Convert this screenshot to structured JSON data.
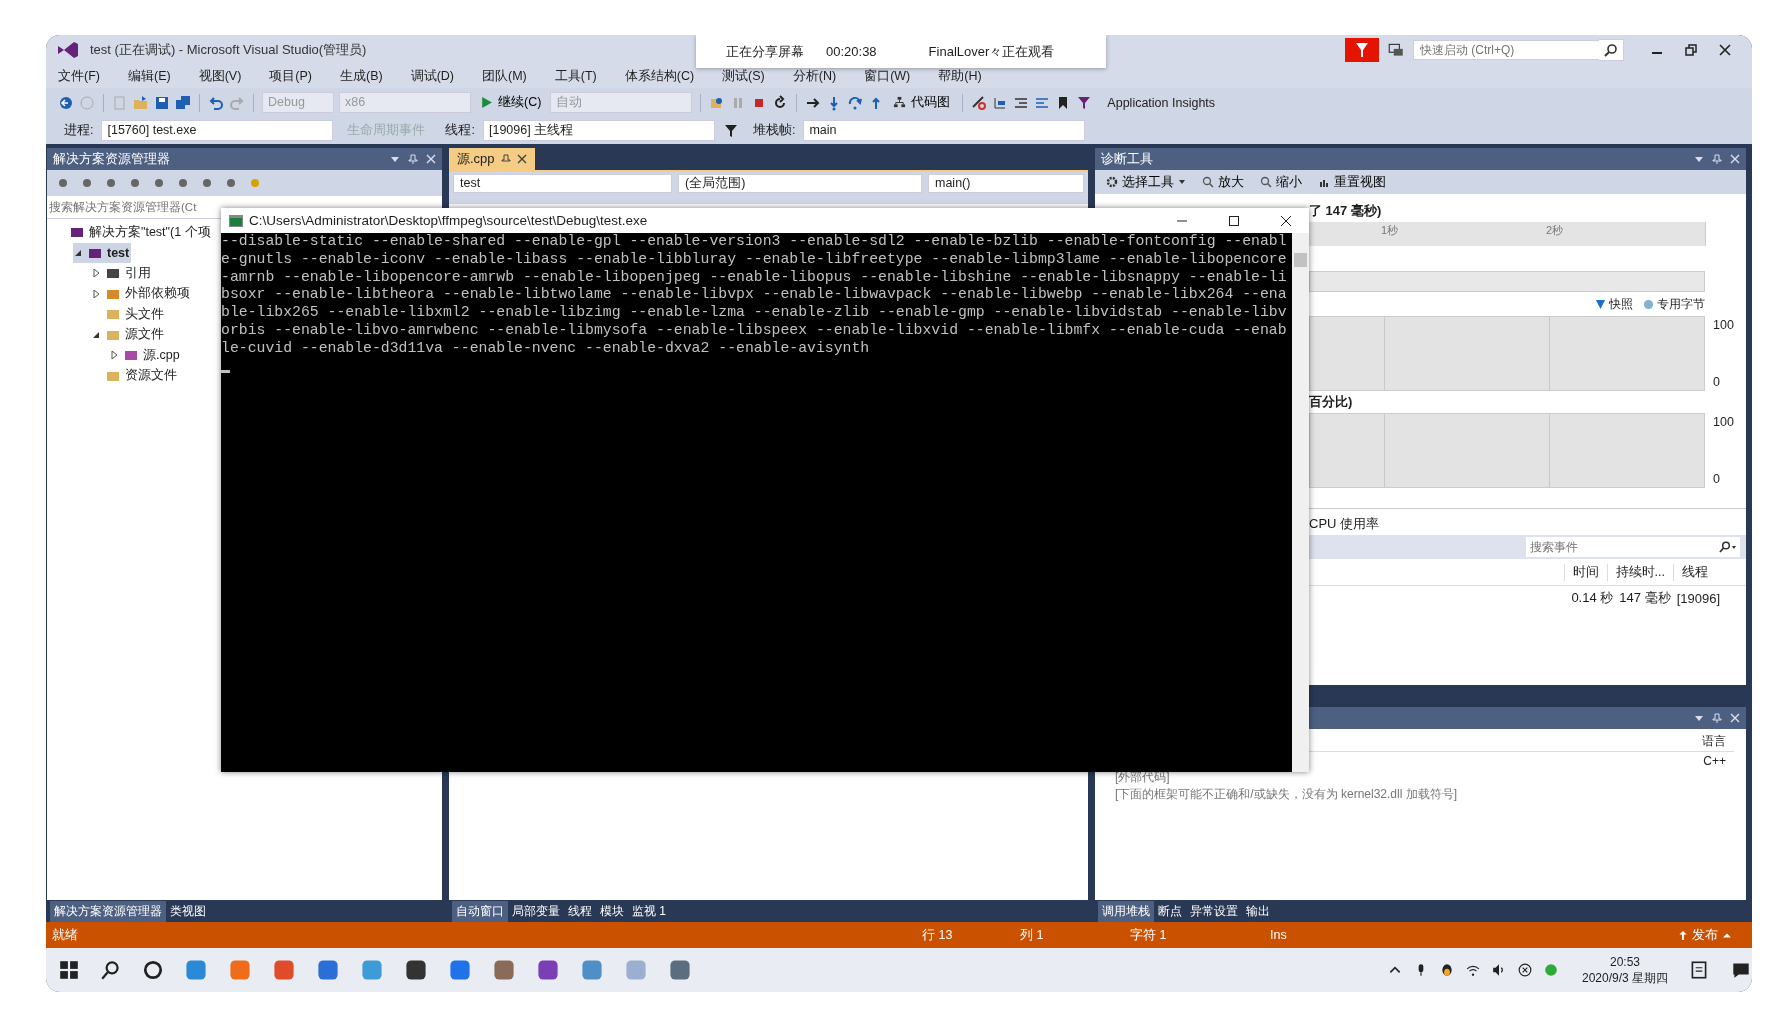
{
  "window": {
    "title": "test (正在调试) - Microsoft Visual Studio(管理员)"
  },
  "share_banner": {
    "status": "正在分享屏幕",
    "time": "00:20:38",
    "viewer": "FinalLover々正在观看"
  },
  "quick_launch": {
    "placeholder": "快速启动 (Ctrl+Q)"
  },
  "menu": [
    "文件(F)",
    "编辑(E)",
    "视图(V)",
    "项目(P)",
    "生成(B)",
    "调试(D)",
    "团队(M)",
    "工具(T)",
    "体系结构(C)",
    "测试(S)",
    "分析(N)",
    "窗口(W)",
    "帮助(H)"
  ],
  "toolbar": {
    "configuration": "Debug",
    "platform": "x86",
    "continue": "继续(C)",
    "auto": "自动",
    "code_map": "代码图",
    "insights": "Application Insights"
  },
  "debug_location": {
    "process_label": "进程:",
    "process": "[15760] test.exe",
    "lifecycle": "生命周期事件",
    "thread_label": "线程:",
    "thread": "[19096] 主线程",
    "stack_label": "堆栈帧:",
    "stack": "main"
  },
  "solution_explorer": {
    "title": "解决方案资源管理器",
    "search": {
      "placeholder": "搜索解决方案资源管理器(Ct"
    },
    "tree": [
      {
        "label": "解决方案\"test\"(1 个项",
        "kind": "solution",
        "selected": false,
        "children": [
          {
            "label": "test",
            "kind": "project",
            "expanded": true,
            "selected": true,
            "children": [
              {
                "label": "引用",
                "kind": "references",
                "expanded": false,
                "selected": false
              },
              {
                "label": "外部依赖项",
                "kind": "external",
                "expanded": false,
                "selected": false
              },
              {
                "label": "头文件",
                "kind": "folder",
                "selected": false
              },
              {
                "label": "源文件",
                "kind": "folder",
                "expanded": true,
                "selected": false,
                "children": [
                  {
                    "label": "源.cpp",
                    "kind": "cpp",
                    "expanded": false,
                    "selected": false
                  }
                ]
              },
              {
                "label": "资源文件",
                "kind": "folder",
                "selected": false
              }
            ]
          }
        ]
      }
    ],
    "tabs": [
      {
        "label": "解决方案资源管理器",
        "selected": true
      },
      {
        "label": "类视图",
        "selected": false
      }
    ]
  },
  "editor": {
    "tabs": [
      {
        "label": "源.cpp",
        "selected": true
      }
    ],
    "project": "test",
    "scope": "(全局范围)",
    "member": "main()"
  },
  "console": {
    "title": "C:\\Users\\Administrator\\Desktop\\ffmpeg\\source\\test\\Debug\\test.exe",
    "lines": [
      "--disable-static --enable-shared --enable-gpl --enable-version3 --enable-sdl2 --enable-bzlib --enable-fontconfig --enabl",
      "e-gnutls --enable-iconv --enable-libass --enable-libbluray --enable-libfreetype --enable-libmp3lame --enable-libopencore",
      "-amrnb --enable-libopencore-amrwb --enable-libopenjpeg --enable-libopus --enable-libshine --enable-libsnappy --enable-li",
      "bsoxr --enable-libtheora --enable-libtwolame --enable-libvpx --enable-libwavpack --enable-libwebp --enable-libx264 --ena",
      "ble-libx265 --enable-libxml2 --enable-libzimg --enable-lzma --enable-zlib --enable-gmp --enable-libvidstab --enable-libv",
      "orbis --enable-libvo-amrwbenc --enable-libmysofa --enable-libspeex --enable-libxvid --enable-libmfx --enable-cuda --enab",
      "le-cuvid --enable-d3d11va --enable-nvenc --enable-dxva2 --enable-avisynth"
    ]
  },
  "autos": {
    "tabs": [
      {
        "label": "自动窗口",
        "selected": true
      },
      {
        "label": "局部变量",
        "selected": false
      },
      {
        "label": "线程",
        "selected": false
      },
      {
        "label": "模块",
        "selected": false
      },
      {
        "label": "监视 1",
        "selected": false
      }
    ]
  },
  "diagnostics": {
    "title": "诊断工具",
    "select_tool": "选择工具",
    "zoom_in": "放大",
    "zoom_out": "缩小",
    "reset_view": "重置视图",
    "session": "了 147 毫秒)",
    "ticks": [
      "1秒",
      "2秒"
    ],
    "legend": [
      {
        "label": "快照",
        "kind": "triangle",
        "color": "#1a6fd1"
      },
      {
        "label": "专用字节",
        "kind": "dot",
        "color": "#7fb2d6"
      }
    ],
    "memory_axis": [
      "100",
      "0"
    ],
    "cpu_title": "百分比)",
    "cpu_axis": [
      "100",
      "0"
    ],
    "cpu_usage": "CPU 使用率",
    "search": {
      "placeholder": "搜索事件"
    },
    "columns": [
      "时间",
      "持续时...",
      "线程"
    ],
    "rows": [
      [
        "0.14 秒",
        "147 毫秒",
        "[19096]"
      ]
    ]
  },
  "call_stack": {
    "columns": [
      "语言"
    ],
    "rows": [
      {
        "name": "",
        "language": "C++"
      },
      {
        "name": "[外部代码]",
        "language": ""
      },
      {
        "name": "[下面的框架可能不正确和/或缺失，没有为 kernel32.dll 加载符号]",
        "language": ""
      }
    ],
    "tabs": [
      {
        "label": "调用堆栈",
        "selected": true
      },
      {
        "label": "断点",
        "selected": false
      },
      {
        "label": "异常设置",
        "selected": false
      },
      {
        "label": "输出",
        "selected": false
      }
    ]
  },
  "status_bar": {
    "state": "就绪",
    "line": "行 13",
    "column": "列 1",
    "char": "字符 1",
    "mode": "Ins",
    "publish": "发布"
  },
  "taskbar": {
    "time": "20:53",
    "date": "2020/9/3 星期四"
  }
}
